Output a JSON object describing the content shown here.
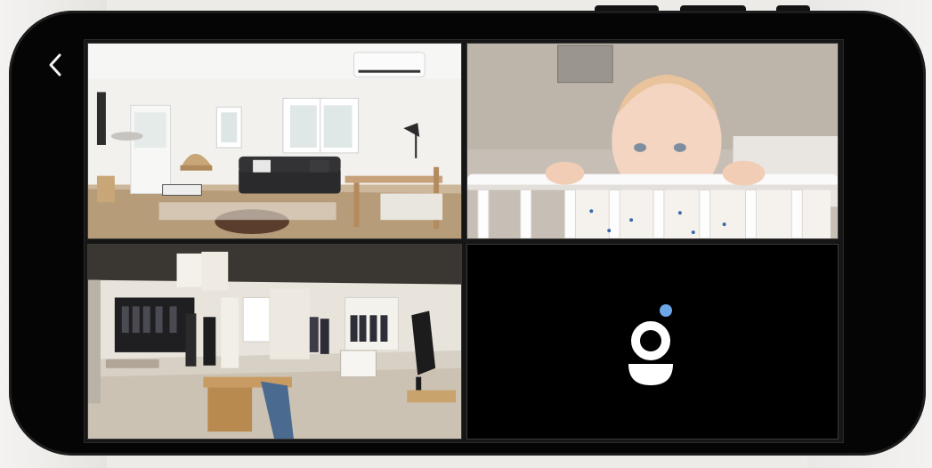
{
  "screen": {
    "back_icon": "chevron-left-icon",
    "accent_color": "#6aa6e8",
    "cameras": [
      {
        "scene": "living-room"
      },
      {
        "scene": "nursery-crib"
      },
      {
        "scene": "clothing-store"
      },
      {
        "scene": "empty-slot",
        "icon": "app-logo-icon"
      }
    ]
  }
}
